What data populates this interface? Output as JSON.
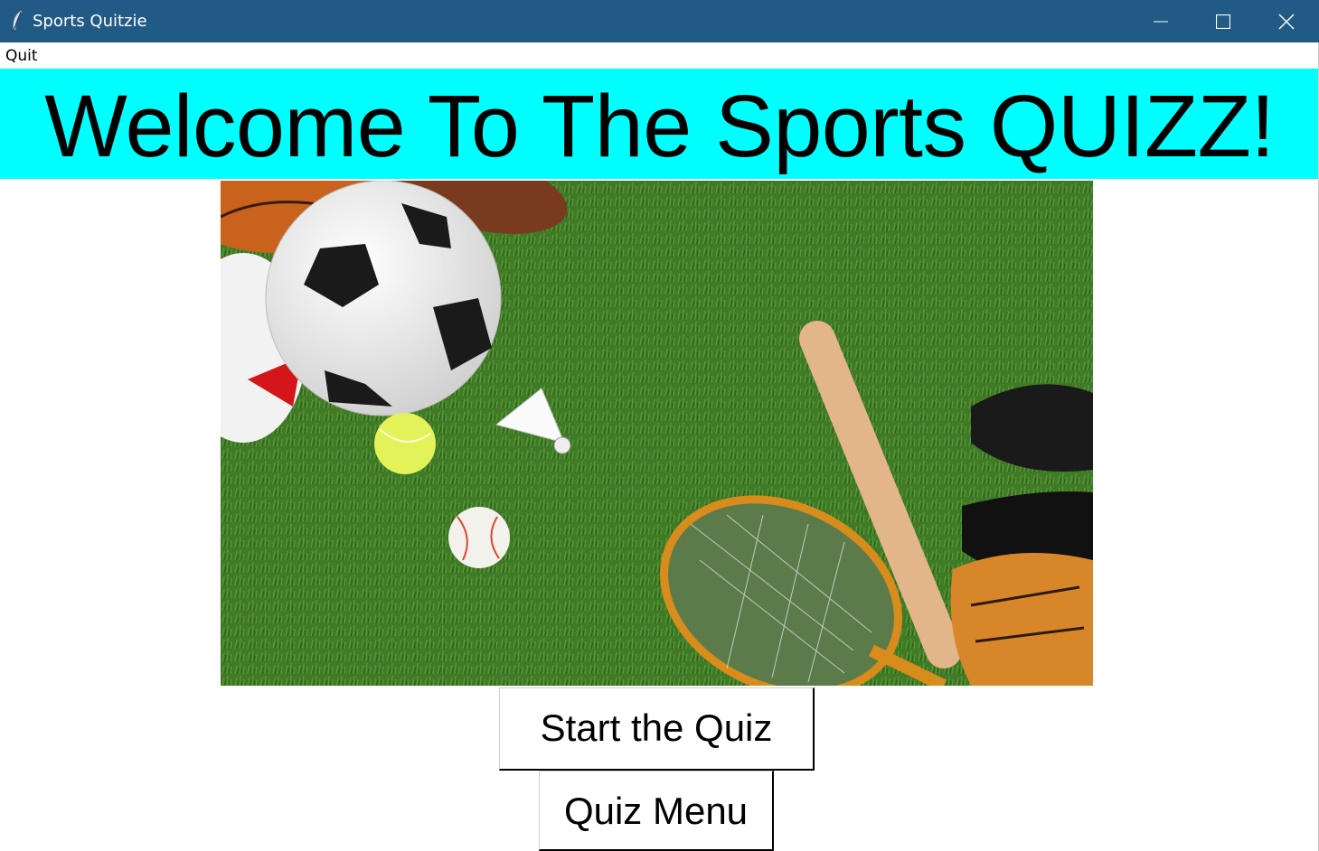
{
  "window": {
    "title": "Sports Quitzie",
    "icon": "feather-icon",
    "controls": [
      "minimize-icon",
      "maximize-icon",
      "close-icon"
    ],
    "titlebar_color": "#215a84"
  },
  "menu": {
    "items": [
      {
        "label": "Quit"
      }
    ]
  },
  "banner": {
    "text": "Welcome To The Sports QUIZZ!",
    "background": "#00ffff"
  },
  "image": {
    "subject": "sports equipment on grass"
  },
  "buttons": {
    "start": "Start the Quiz",
    "menu": "Quiz Menu"
  }
}
